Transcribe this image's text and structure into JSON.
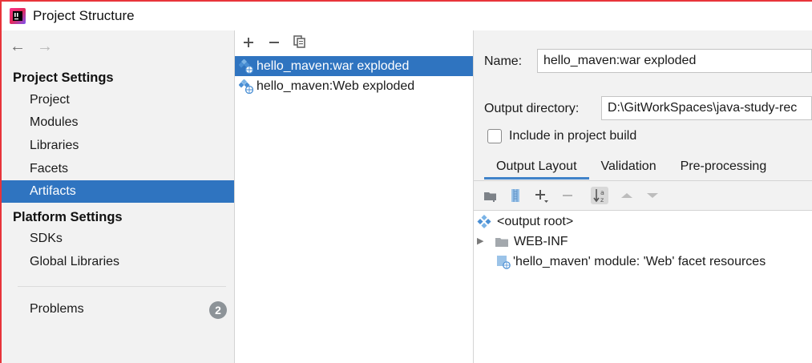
{
  "window": {
    "title": "Project Structure"
  },
  "sidebar": {
    "project_settings_heading": "Project Settings",
    "project_items": [
      "Project",
      "Modules",
      "Libraries",
      "Facets",
      "Artifacts"
    ],
    "selected_item": "Artifacts",
    "platform_settings_heading": "Platform Settings",
    "platform_items": [
      "SDKs",
      "Global Libraries"
    ],
    "problems": {
      "label": "Problems",
      "count": "2"
    }
  },
  "artifacts_list": {
    "toolbar_icons": [
      "plus-icon",
      "minus-icon",
      "copy-icon"
    ],
    "items": [
      {
        "label": "hello_maven:war exploded",
        "selected": true
      },
      {
        "label": "hello_maven:Web exploded",
        "selected": false
      }
    ]
  },
  "detail": {
    "name_label": "Name:",
    "name_value": "hello_maven:war exploded",
    "output_label": "Output directory:",
    "output_value": "D:\\GitWorkSpaces\\java-study-rec",
    "include_label": "Include in project build",
    "include_checked": false,
    "tabs": [
      "Output Layout",
      "Validation",
      "Pre-processing"
    ],
    "active_tab": "Output Layout",
    "tree_toolbar_icons": [
      "new-folder-icon",
      "archive-icon",
      "add-icon",
      "remove-icon",
      "sort-icon",
      "move-up-icon",
      "move-down-icon"
    ],
    "tree": {
      "root": "<output root>",
      "folder": "WEB-INF",
      "resource": "'hello_maven' module: 'Web' facet resources"
    }
  },
  "colors": {
    "selection": "#2f74c0",
    "panel": "#f2f2f2",
    "badge": "#8d9398"
  }
}
